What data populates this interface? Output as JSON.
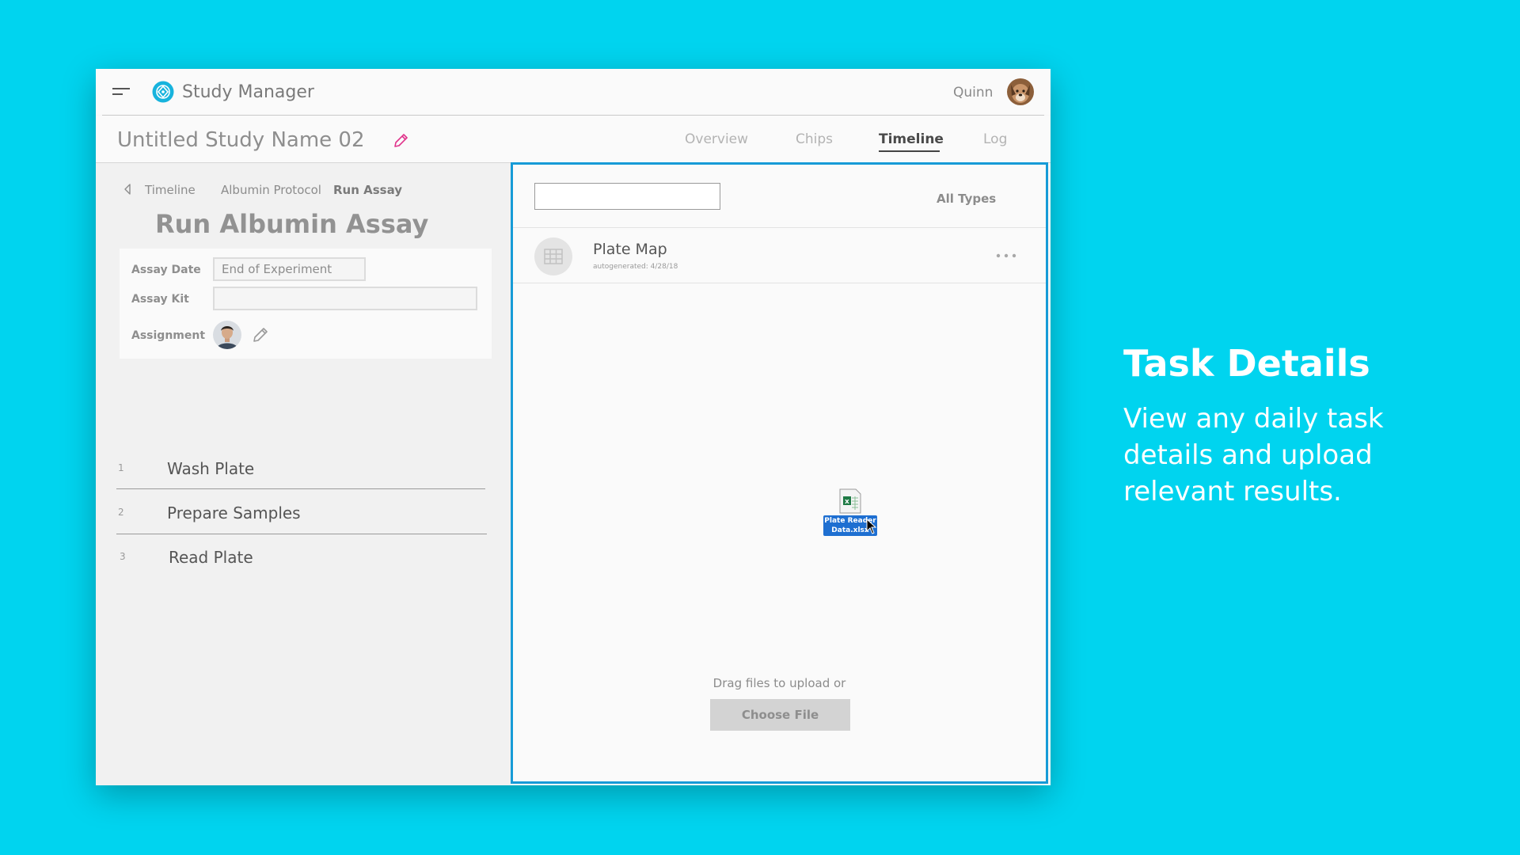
{
  "app": {
    "title": "Study Manager",
    "user_name": "Quinn"
  },
  "study": {
    "name": "Untitled Study Name 02"
  },
  "tabs": [
    {
      "label": "Overview",
      "active": false
    },
    {
      "label": "Chips",
      "active": false
    },
    {
      "label": "Timeline",
      "active": true
    },
    {
      "label": "Log",
      "active": false
    }
  ],
  "breadcrumb": [
    "Timeline",
    "Albumin Protocol",
    "Run Assay"
  ],
  "task": {
    "title": "Run Albumin Assay",
    "fields": {
      "assay_date_label": "Assay Date",
      "assay_date_value": "End of Experiment",
      "assay_kit_label": "Assay Kit",
      "assay_kit_value": "",
      "assignment_label": "Assignment"
    }
  },
  "steps": [
    {
      "num": "1",
      "label": "Wash Plate"
    },
    {
      "num": "2",
      "label": "Prepare Samples"
    },
    {
      "num": "3",
      "label": "Read Plate"
    }
  ],
  "files": {
    "search_value": "",
    "type_filter": "All Types",
    "items": [
      {
        "name": "Plate Map",
        "meta": "autogenerated: 4/28/18",
        "icon": "grid-icon"
      }
    ],
    "dragging_file": "Plate Reader Data.xlsx",
    "drop_text": "Drag files to upload or",
    "choose_label": "Choose File"
  },
  "promo": {
    "heading": "Task Details",
    "body": "View any daily task details and upload relevant results."
  },
  "colors": {
    "background": "#00d4ef",
    "accent": "#169bd7",
    "logo": "#17b3dd",
    "edit_pink": "#e0328a",
    "drag_label": "#1e6fd1"
  }
}
